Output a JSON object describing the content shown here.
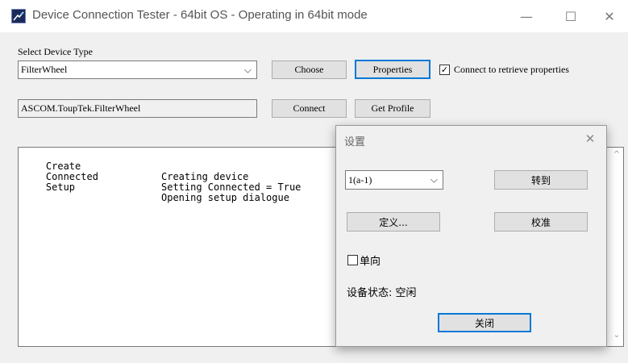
{
  "window": {
    "title": "Device Connection Tester - 64bit OS - Operating in 64bit mode",
    "minimize_glyph": "—",
    "maximize_glyph": "☐",
    "close_glyph": "✕"
  },
  "device": {
    "select_label": "Select Device Type",
    "device_type_value": "FilterWheel",
    "choose_label": "Choose",
    "properties_label": "Properties",
    "connect_props_label": "Connect to retrieve properties",
    "connect_props_checked": "✓",
    "driver_id": "ASCOM.ToupTek.FilterWheel",
    "connect_label": "Connect",
    "get_profile_label": "Get Profile"
  },
  "log": {
    "rows": [
      {
        "action": "Create",
        "message": "Creating device"
      },
      {
        "action": "Connected",
        "message": "Setting Connected = True"
      },
      {
        "action": "Setup",
        "message": "Opening setup dialogue"
      }
    ]
  },
  "dialog": {
    "title": "设置",
    "close_glyph": "✕",
    "position_value": "1(a-1)",
    "goto_label": "转到",
    "define_label": "定义...",
    "calibrate_label": "校准",
    "unidirectional_label": "单向",
    "status_label": "设备状态: 空闲",
    "close_label": "关闭"
  },
  "icons": {
    "dropdown": "chevron-down-icon",
    "scroll_up": "scroll-up-arrow-icon",
    "scroll_down": "scroll-down-arrow-icon",
    "app": "telescope-app-icon"
  },
  "colors": {
    "accent": "#0078d7",
    "window_bg": "#f0f0f0"
  }
}
